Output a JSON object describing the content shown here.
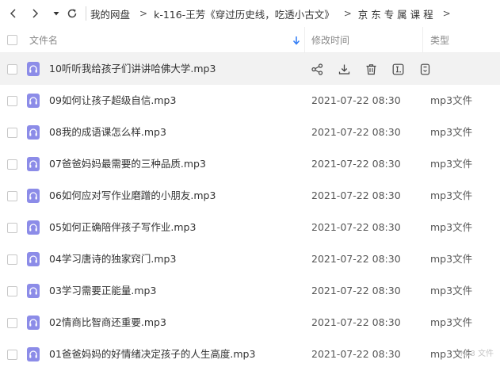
{
  "breadcrumb": {
    "items": [
      "我的网盘",
      "k-116-王芳《穿过历史线，吃透小古文》",
      "京 东 专 属 课 程"
    ],
    "separator": ">"
  },
  "header": {
    "name_label": "文件名",
    "modified_label": "修改时间",
    "type_label": "类型"
  },
  "files": [
    {
      "name": "10听听我给孩子们讲讲哈佛大学.mp3",
      "date": "",
      "type": ""
    },
    {
      "name": "09如何让孩子超级自信.mp3",
      "date": "2021-07-22 08:30",
      "type": "mp3文件"
    },
    {
      "name": "08我的成语课怎么样.mp3",
      "date": "2021-07-22 08:30",
      "type": "mp3文件"
    },
    {
      "name": "07爸爸妈妈最需要的三种品质.mp3",
      "date": "2021-07-22 08:30",
      "type": "mp3文件"
    },
    {
      "name": "06如何应对写作业磨蹭的小朋友.mp3",
      "date": "2021-07-22 08:30",
      "type": "mp3文件"
    },
    {
      "name": "05如何正确陪伴孩子写作业.mp3",
      "date": "2021-07-22 08:30",
      "type": "mp3文件"
    },
    {
      "name": "04学习唐诗的独家窍门.mp3",
      "date": "2021-07-22 08:30",
      "type": "mp3文件"
    },
    {
      "name": "03学习需要正能量.mp3",
      "date": "2021-07-22 08:30",
      "type": "mp3文件"
    },
    {
      "name": "02情商比智商还重要.mp3",
      "date": "2021-07-22 08:30",
      "type": "mp3文件"
    },
    {
      "name": "01爸爸妈妈的好情绪决定孩子的人生高度.mp3",
      "date": "2021-07-22 08:30",
      "type": "mp3文件"
    }
  ],
  "watermark": "mp3 文件",
  "colors": {
    "file_icon": "#8c8ce8",
    "hover_row": "#f2f2f2",
    "sort_arrow": "#2f7bf5"
  },
  "icons": {
    "back": "chevron-left-icon",
    "forward": "chevron-right-icon",
    "history": "caret-down-icon",
    "refresh": "refresh-icon",
    "sort": "sort-down-arrow-icon",
    "file": "audio-file-icon",
    "row_actions": [
      "share-icon",
      "download-icon",
      "delete-icon",
      "rename-icon",
      "more-icon"
    ]
  }
}
